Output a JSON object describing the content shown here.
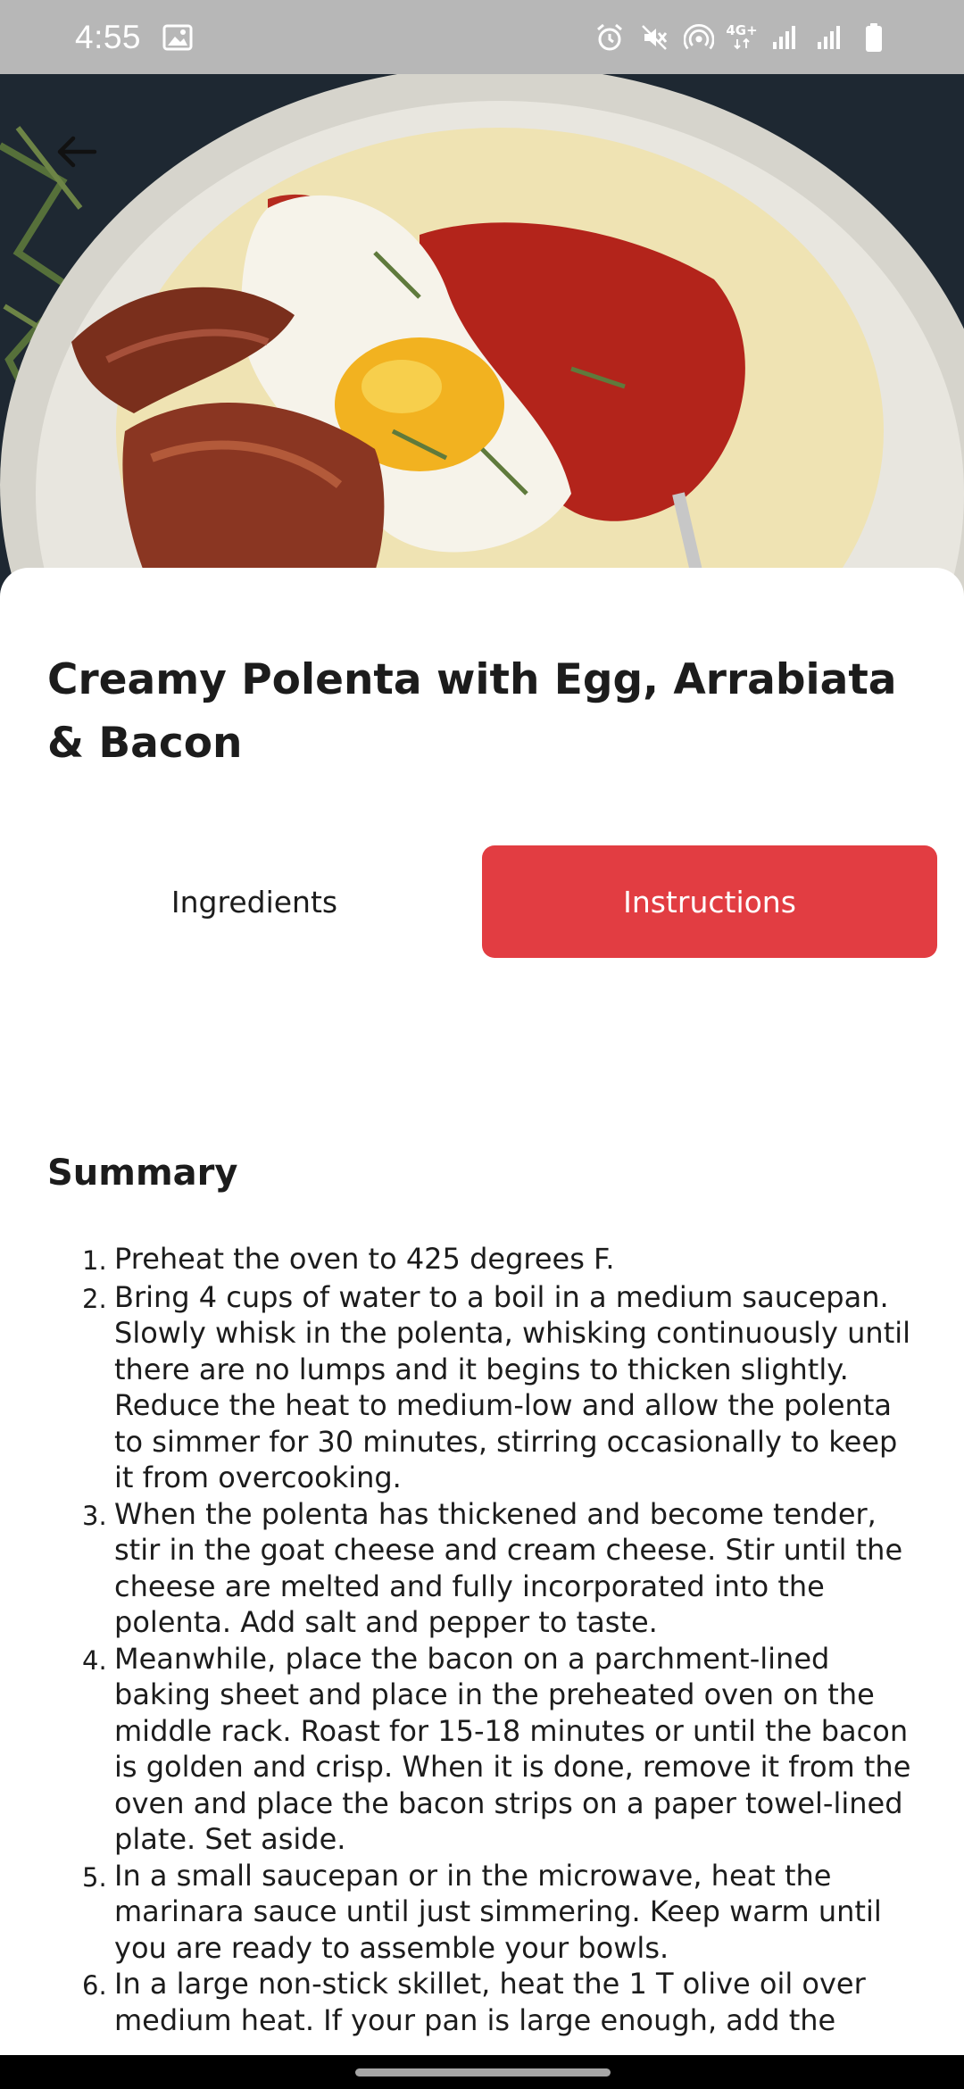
{
  "status_bar": {
    "time": "4:55",
    "network_label": "4G+",
    "icons": [
      "image-icon",
      "alarm-icon",
      "mute-icon",
      "hotspot-icon",
      "signal-icon",
      "signal-icon",
      "battery-icon"
    ]
  },
  "hero": {
    "image_description_icon": "recipe-photo"
  },
  "recipe": {
    "title": "Creamy Polenta with Egg, Arrabiata & Bacon"
  },
  "tabs": [
    {
      "label": "Ingredients",
      "selected": false
    },
    {
      "label": "Instructions",
      "selected": true
    }
  ],
  "summary": {
    "heading": "Summary",
    "steps": [
      {
        "num": "1.",
        "text": "Preheat the oven to 425 degrees F."
      },
      {
        "num": "2.",
        "text": "Bring 4 cups of water to a boil in a medium saucepan. Slowly whisk in the polenta, whisking continuously until there are no lumps and it begins to thicken slightly. Reduce the heat to medium-low and allow the polenta to simmer for 30 minutes, stirring occasionally to keep it from overcooking."
      },
      {
        "num": "3.",
        "text": "When the polenta has thickened and become tender, stir in the goat cheese and cream cheese. Stir until the cheese are melted and fully incorporated into the polenta. Add salt and pepper to taste."
      },
      {
        "num": "4.",
        "text": "Meanwhile, place the bacon on a parchment-lined baking sheet and place in the preheated oven on the middle rack. Roast for 15-18 minutes or until the bacon is golden and crisp. When it is done, remove it from the oven and place the bacon strips on a paper towel-lined plate. Set aside."
      },
      {
        "num": "5.",
        "text": "In a small saucepan or in the microwave, heat the marinara sauce until just simmering. Keep warm until you are ready to assemble your bowls."
      },
      {
        "num": "6.",
        "text": "In a large non-stick skillet, heat the 1 T olive oil over medium heat. If your pan is large enough, add the"
      }
    ]
  },
  "colors": {
    "accent": "#e23d42",
    "status_bar": "#b7b7b7",
    "text": "#1c1c1c"
  }
}
